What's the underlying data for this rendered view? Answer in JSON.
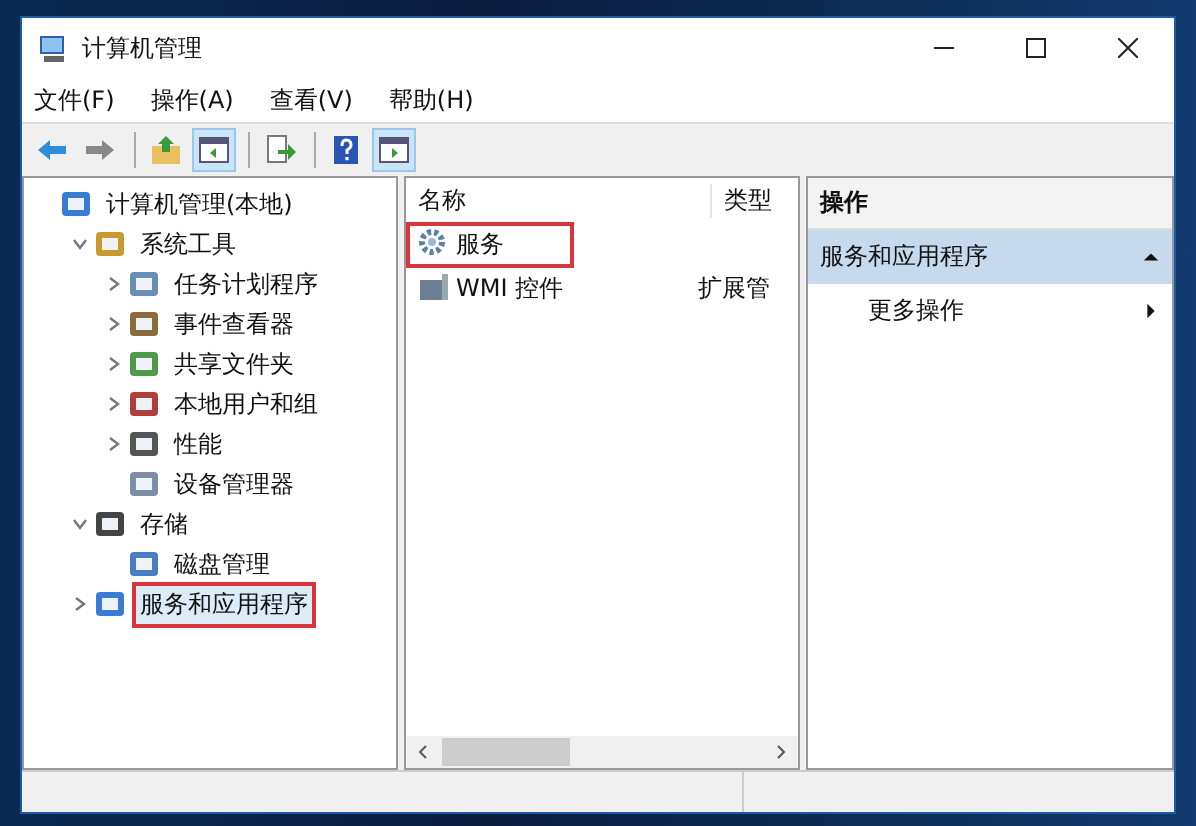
{
  "window": {
    "title": "计算机管理"
  },
  "menu": [
    "文件(F)",
    "操作(A)",
    "查看(V)",
    "帮助(H)"
  ],
  "toolbar": [
    {
      "kind": "back",
      "pressed": false
    },
    {
      "kind": "forward",
      "pressed": false
    },
    {
      "kind": "separator"
    },
    {
      "kind": "up",
      "pressed": false
    },
    {
      "kind": "tree",
      "pressed": true
    },
    {
      "kind": "separator"
    },
    {
      "kind": "export",
      "pressed": false
    },
    {
      "kind": "separator"
    },
    {
      "kind": "help",
      "pressed": false
    },
    {
      "kind": "pane",
      "pressed": true
    }
  ],
  "tree": [
    {
      "label": "计算机管理(本地)",
      "highlighted": false,
      "children": [
        {
          "label": "系统工具",
          "expanded": true,
          "highlighted": false,
          "children": [
            {
              "label": "任务计划程序",
              "expanded": false,
              "highlighted": false
            },
            {
              "label": "事件查看器",
              "expanded": false,
              "highlighted": false
            },
            {
              "label": "共享文件夹",
              "expanded": false,
              "highlighted": false
            },
            {
              "label": "本地用户和组",
              "expanded": false,
              "highlighted": false
            },
            {
              "label": "性能",
              "expanded": false,
              "highlighted": false
            },
            {
              "label": "设备管理器",
              "highlighted": false
            }
          ]
        },
        {
          "label": "存储",
          "expanded": true,
          "highlighted": false,
          "children": [
            {
              "label": "磁盘管理",
              "highlighted": false
            }
          ]
        },
        {
          "label": "服务和应用程序",
          "expanded": false,
          "highlighted": true
        }
      ]
    }
  ],
  "list": {
    "columns": [
      "名称",
      "类型"
    ],
    "rows": [
      {
        "name": "服务",
        "highlighted": true
      },
      {
        "name": "WMI 控件",
        "type": "扩展管",
        "highlighted": false
      }
    ]
  },
  "actions": {
    "title": "操作",
    "sections": [
      {
        "label": "服务和应用程序",
        "items": [
          "更多操作"
        ]
      }
    ]
  }
}
